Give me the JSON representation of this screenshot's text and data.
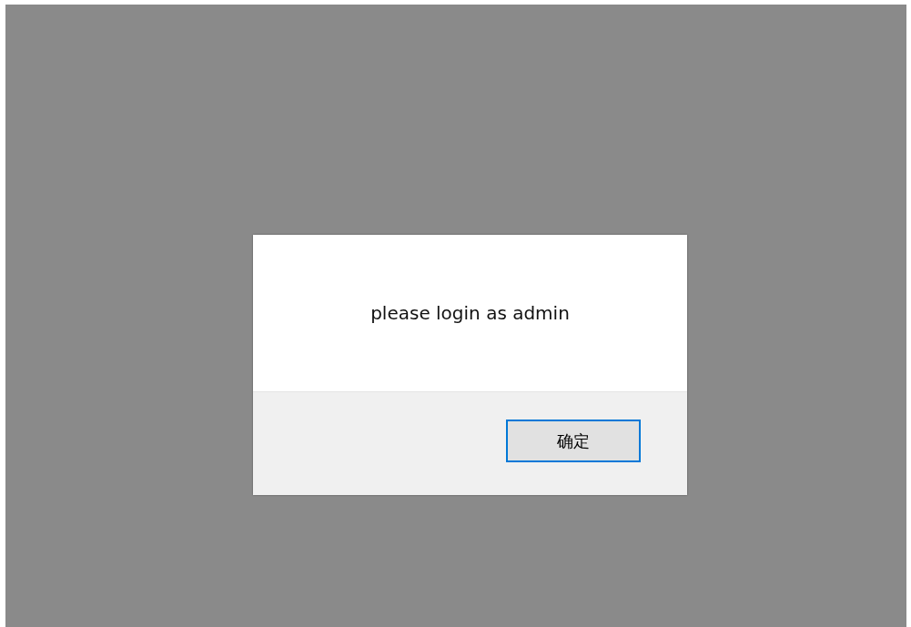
{
  "dialog": {
    "message": "please login as admin",
    "buttons": [
      {
        "label": "确定",
        "focused": true
      }
    ]
  }
}
